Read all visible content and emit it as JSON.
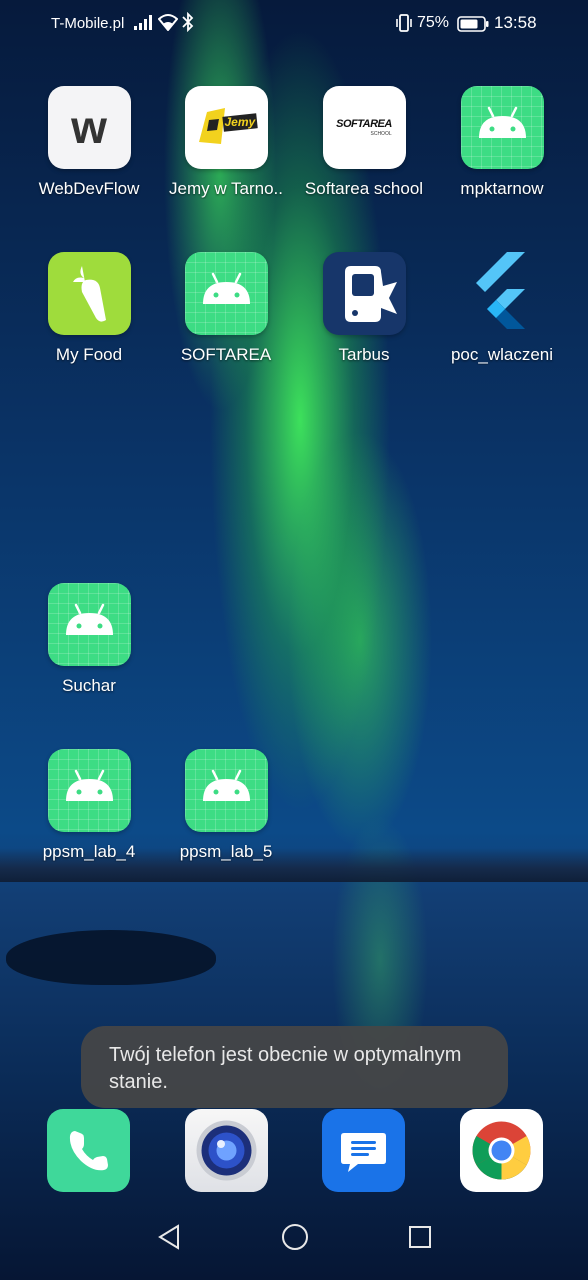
{
  "status_bar": {
    "carrier": "T-Mobile.pl",
    "battery_percent": "75%",
    "time": "13:58"
  },
  "apps": [
    {
      "label": "WebDevFlow",
      "icon": "webdevflow-icon",
      "logo_text": "w"
    },
    {
      "label": "Jemy w Tarno..",
      "icon": "jemy-icon",
      "logo_text": "Jemy"
    },
    {
      "label": "Softarea school",
      "icon": "softarea-school-icon",
      "logo_text": "SOFTAREA",
      "logo_subtext": "SCHOOL"
    },
    {
      "label": "mpktarnow",
      "icon": "android-icon"
    },
    {
      "label": "My Food",
      "icon": "carrot-icon"
    },
    {
      "label": "SOFTAREA",
      "icon": "android-icon"
    },
    {
      "label": "Tarbus",
      "icon": "bus-icon"
    },
    {
      "label": "poc_wlaczeni",
      "icon": "flutter-icon"
    },
    {
      "label": "Suchar",
      "icon": "android-icon"
    },
    {
      "label": "ppsm_lab_4",
      "icon": "android-icon"
    },
    {
      "label": "ppsm_lab_5",
      "icon": "android-icon"
    }
  ],
  "toast": {
    "text": "Twój telefon jest obecnie w optymalnym stanie."
  },
  "dock": [
    {
      "name": "phone",
      "icon": "phone-icon"
    },
    {
      "name": "camera",
      "icon": "camera-icon"
    },
    {
      "name": "messages",
      "icon": "messages-icon"
    },
    {
      "name": "chrome",
      "icon": "chrome-icon"
    }
  ],
  "colors": {
    "android_green": "#3ddc84",
    "phone_green": "#3fd89a",
    "messages_blue": "#1a73e8",
    "tarbus_navy": "#17366a"
  }
}
